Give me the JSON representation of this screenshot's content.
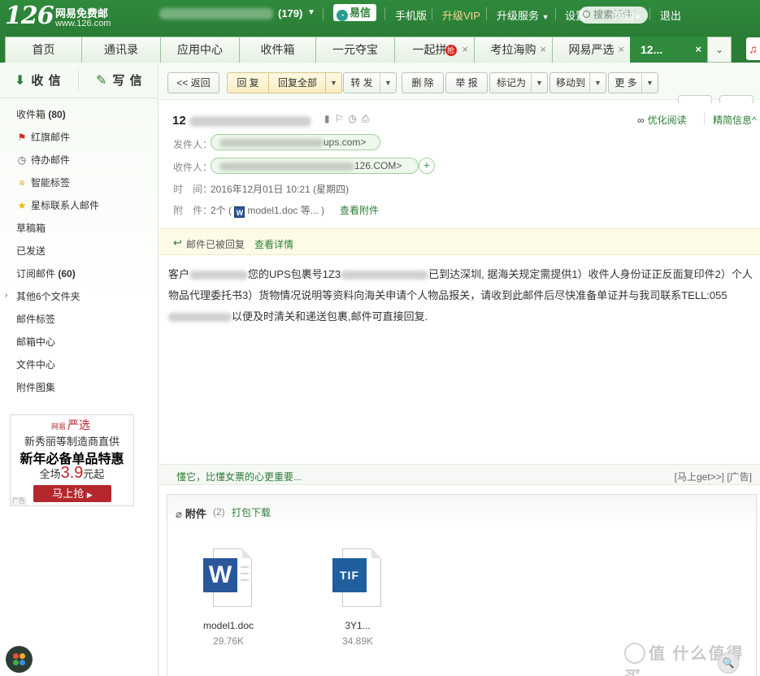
{
  "top": {
    "logo_num": "126",
    "logo_text": "网易免费邮",
    "logo_url": "www.126.com",
    "unread_count": "(179)",
    "yixin": "易信",
    "links": [
      "手机版",
      "升级VIP",
      "升级服务",
      "设置",
      "帮助",
      "退出"
    ],
    "search_placeholder": "搜索邮件"
  },
  "tabs": [
    {
      "label": "首页"
    },
    {
      "label": "通讯录"
    },
    {
      "label": "应用中心"
    },
    {
      "label": "收件箱"
    },
    {
      "label": "一元夺宝"
    },
    {
      "label": "一起拼",
      "badge": "抢"
    },
    {
      "label": "考拉海购"
    },
    {
      "label": "网易严选"
    },
    {
      "label": "12..."
    }
  ],
  "sidebar": {
    "receive": "收 信",
    "write": "写 信",
    "folders": [
      {
        "label": "收件箱",
        "count": "(80)"
      },
      {
        "label": "红旗邮件",
        "icon": "flag-icon"
      },
      {
        "label": "待办邮件",
        "icon": "clock-icon"
      },
      {
        "label": "智能标签",
        "icon": "tag-icon"
      },
      {
        "label": "星标联系人邮件",
        "icon": "star-icon"
      },
      {
        "label": "草稿箱"
      },
      {
        "label": "已发送"
      },
      {
        "label": "订阅邮件",
        "count": "(60)"
      },
      {
        "label": "其他6个文件夹"
      },
      {
        "label": "邮件标签"
      },
      {
        "label": "邮箱中心"
      },
      {
        "label": "文件中心"
      },
      {
        "label": "附件图集"
      }
    ],
    "ad": {
      "brand_small": "网易",
      "brand": "严选",
      "line1": "新秀丽等制造商直供",
      "line2": "新年必备单品特惠",
      "line3_pre": "全场",
      "line3_price": "3.9",
      "line3_post": "元起",
      "button": "马上抢",
      "tag": "广告"
    }
  },
  "toolbar": {
    "back": "返回",
    "reply": "回 复",
    "reply_all": "回复全部",
    "forward": "转 发",
    "delete": "删 除",
    "report": "举 报",
    "mark_as": "标记为",
    "move_to": "移动到",
    "more": "更 多"
  },
  "mail": {
    "subject_prefix": "12",
    "read_optimize": "优化阅读",
    "brief_info": "精简信息",
    "from_label": "发件人：",
    "from_value": "ups.com>",
    "to_label": "收件人：",
    "to_value": "126.COM>",
    "time_label": "时　间：",
    "time_value": "2016年12月01日 10:21 (星期四)",
    "attach_label": "附　件：",
    "attach_value": "2个 (",
    "attach_file": "model1.doc 等... )",
    "view_attach": "查看附件",
    "replied_text": "邮件已被回复",
    "replied_detail": "查看详情",
    "body_p1": "您的UPS包裹号1Z3",
    "body_p1_prefix": "客户",
    "body_p2": "已到达深圳, 据海关规定需提供1）收件人身份证正反面复印件2）个人物品代理委托书3）货物情况说明等资料向海关申请个人物品报关，请收到此邮件后尽快准备单证并与我司联系TELL:055",
    "body_p3": "以便及时清关和递送包裹,邮件可直接回复.",
    "ad_left": "懂它，比懂女票的心更重要...",
    "ad_right_link": "[马上get>>]",
    "ad_right_tag": "[广告]"
  },
  "attachments": {
    "title": "附件",
    "count": "(2)",
    "download": "打包下载",
    "files": [
      {
        "name": "model1.doc",
        "size": "29.76K",
        "type": "W"
      },
      {
        "name": "3Y1...",
        "size": "34.89K",
        "type": "TIF"
      }
    ]
  },
  "watermark": "值 什么值得买",
  "colors": {
    "brand_green": "#2a7d35",
    "link_green": "#2a7d35",
    "ad_red": "#b4282d"
  }
}
